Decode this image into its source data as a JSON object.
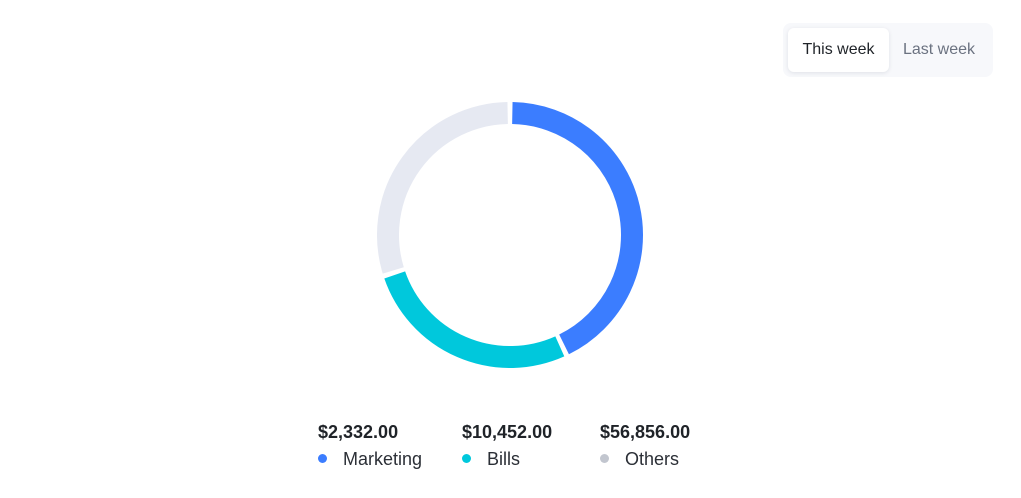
{
  "tabs": [
    {
      "label": "This week",
      "active": true
    },
    {
      "label": "Last week",
      "active": false
    }
  ],
  "chart_data": {
    "type": "pie",
    "style": "donut",
    "title": "",
    "categories": [
      "Marketing",
      "Bills",
      "Others"
    ],
    "values": [
      2332.0,
      10452.0,
      56856.0
    ],
    "value_labels": [
      "$2,332.00",
      "$10,452.00",
      "$56,856.00"
    ],
    "share_shown_percent": [
      43,
      27,
      30
    ],
    "colors": [
      "#3b7dff",
      "#00c8dc",
      "#e6e9f2"
    ],
    "legend_marker_colors": [
      "#3b7dff",
      "#00c8dc",
      "#c2c6cf"
    ],
    "legend_placement": "bottom"
  }
}
